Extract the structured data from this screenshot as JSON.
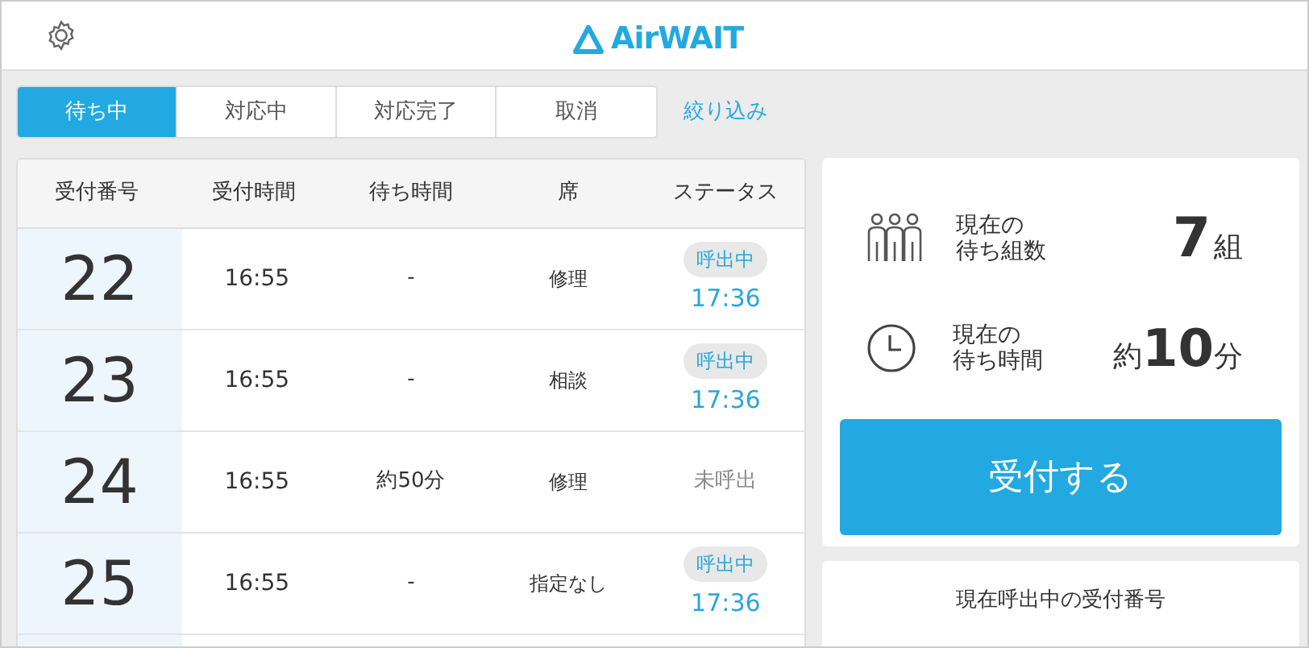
{
  "header": {
    "logo": "AirWAIT"
  },
  "tabs": [
    {
      "label": "待ち中",
      "selected": true
    },
    {
      "label": "対応中",
      "selected": false
    },
    {
      "label": "対応完了",
      "selected": false
    },
    {
      "label": "取消",
      "selected": false
    }
  ],
  "filter_link": "絞り込み",
  "table": {
    "columns": [
      "受付番号",
      "受付時間",
      "待ち時間",
      "席",
      "ステータス"
    ],
    "rows": [
      {
        "number": "22",
        "time": "16:55",
        "wait": "-",
        "seat": "修理",
        "status": {
          "kind": "calling",
          "label": "呼出中",
          "time": "17:36"
        }
      },
      {
        "number": "23",
        "time": "16:55",
        "wait": "-",
        "seat": "相談",
        "status": {
          "kind": "calling",
          "label": "呼出中",
          "time": "17:36"
        }
      },
      {
        "number": "24",
        "time": "16:55",
        "wait": "約50分",
        "seat": "修理",
        "status": {
          "kind": "not_called",
          "label": "未呼出"
        }
      },
      {
        "number": "25",
        "time": "16:55",
        "wait": "-",
        "seat": "指定なし",
        "status": {
          "kind": "calling",
          "label": "呼出中",
          "time": "17:36"
        }
      }
    ]
  },
  "summary": {
    "groups": {
      "label_line1": "現在の",
      "label_line2": "待ち組数",
      "value": "7",
      "unit": "組"
    },
    "wait": {
      "label_line1": "現在の",
      "label_line2": "待ち時間",
      "prefix": "約",
      "value": "10",
      "unit": "分"
    },
    "accept_button": "受付する"
  },
  "called_panel": {
    "title": "現在呼出中の受付番号"
  }
}
